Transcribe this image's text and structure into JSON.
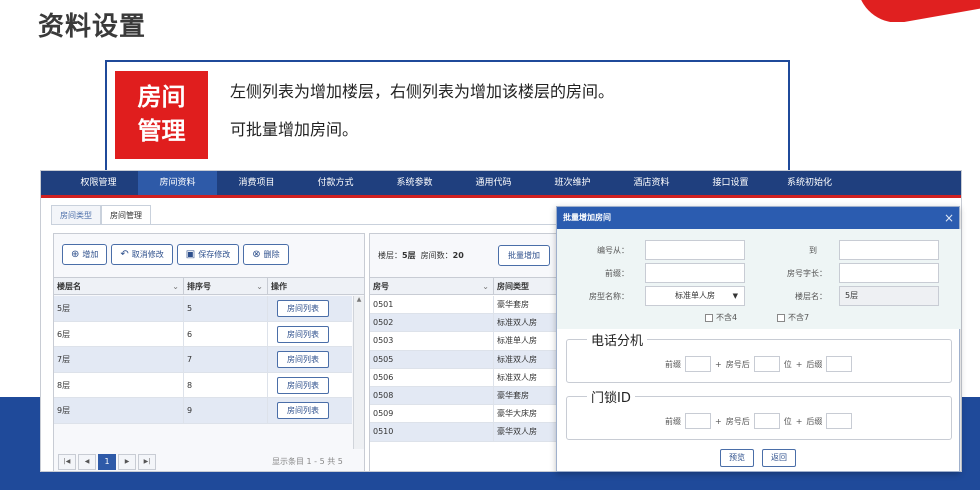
{
  "slide": {
    "title": "资料设置",
    "badge_line1": "房间",
    "badge_line2": "管理",
    "desc_line1": "左侧列表为增加楼层，右侧列表为增加该楼层的房间。",
    "desc_line2": "可批量增加房间。",
    "brand_blue": "#1f4a9a",
    "brand_red": "#e01e1e"
  },
  "nav": {
    "items": [
      "权限管理",
      "房间资料",
      "消费项目",
      "付款方式",
      "系统参数",
      "通用代码",
      "班次维护",
      "酒店资料",
      "接口设置",
      "系统初始化"
    ],
    "active_index": 1
  },
  "subtabs": {
    "items": [
      "房间类型",
      "房间管理"
    ],
    "active_index": 1
  },
  "floor_panel": {
    "add_label": "增加",
    "cancel_label": "取消修改",
    "save_label": "保存修改",
    "delete_label": "删除",
    "columns": [
      "楼层名",
      "排序号",
      "操作"
    ],
    "rows": [
      {
        "name": "5层",
        "order": "5",
        "action": "房间列表"
      },
      {
        "name": "6层",
        "order": "6",
        "action": "房间列表"
      },
      {
        "name": "7层",
        "order": "7",
        "action": "房间列表"
      },
      {
        "name": "8层",
        "order": "8",
        "action": "房间列表"
      },
      {
        "name": "9层",
        "order": "9",
        "action": "房间列表"
      }
    ],
    "pager": {
      "current": "1",
      "info": "显示条目 1 - 5 共 5"
    }
  },
  "room_panel": {
    "floor_label": "楼层：",
    "floor_value": "5层",
    "count_label": "房间数：",
    "count_value": "20",
    "batch_add_label": "批量增加",
    "columns": [
      "房号",
      "房间类型"
    ],
    "rows": [
      {
        "no": "0501",
        "type": "豪华套房"
      },
      {
        "no": "0502",
        "type": "标准双人房"
      },
      {
        "no": "0503",
        "type": "标准单人房"
      },
      {
        "no": "0505",
        "type": "标准双人房"
      },
      {
        "no": "0506",
        "type": "标准双人房"
      },
      {
        "no": "0508",
        "type": "豪华套房"
      },
      {
        "no": "0509",
        "type": "豪华大床房"
      },
      {
        "no": "0510",
        "type": "豪华双人房"
      }
    ]
  },
  "dialog": {
    "title": "批量增加房间",
    "close": "×",
    "from_label": "编号从：",
    "to_label": "到",
    "prefix_label": "前缀：",
    "length_label": "房号字长：",
    "type_label": "房型名称：",
    "type_value": "标准单人房",
    "floor_label": "楼层名：",
    "floor_value": "5层",
    "exclude4": "不含4",
    "exclude7": "不含7",
    "phone_legend": "电话分机",
    "lock_legend": "门锁ID",
    "pre_label": "前缀",
    "plus1": "+",
    "roomno_after": "房号后",
    "digits": "位",
    "plus2": "+",
    "suffix_label": "后缀",
    "preview_label": "预览",
    "back_label": "返回"
  }
}
